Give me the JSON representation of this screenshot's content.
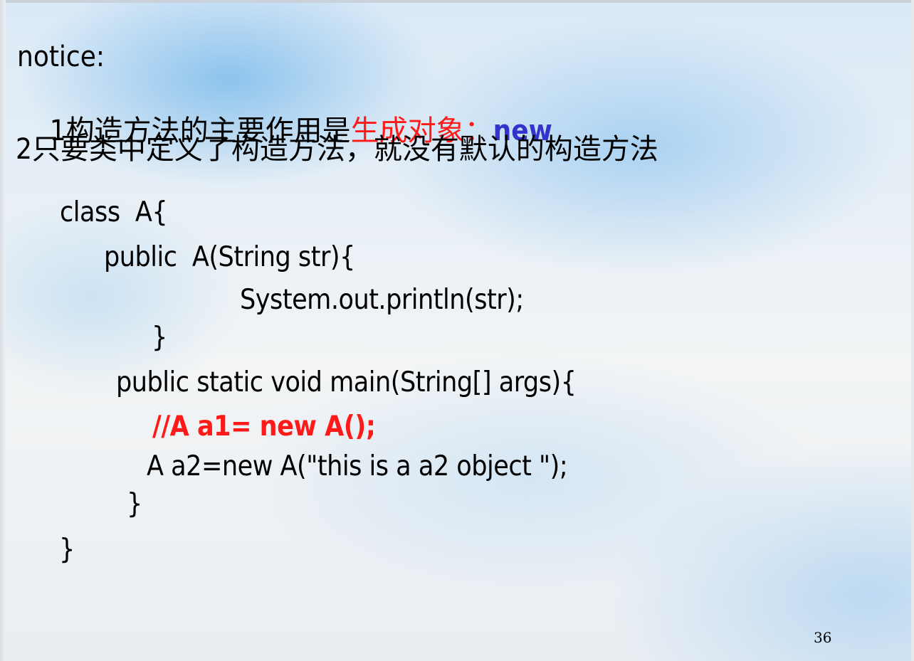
{
  "slide": {
    "notice_label": "notice:",
    "point1": {
      "prefix": "1构造方法的主要作用是",
      "highlight": "生成对象：",
      "keyword": "new"
    },
    "point2": "2只要类中定义了构造方法，就没有默认的构造方法",
    "code": {
      "line1": "class  A{",
      "line2": "public  A(String str){",
      "line3": "System.out.println(str);",
      "line4": "}",
      "line5": "public static void main(String[] args){",
      "line6": "//A a1= new A();",
      "line7": "A a2=new A(\"this is a a2 object \");",
      "line8": "}",
      "line9": "}"
    },
    "page_number": "36"
  }
}
